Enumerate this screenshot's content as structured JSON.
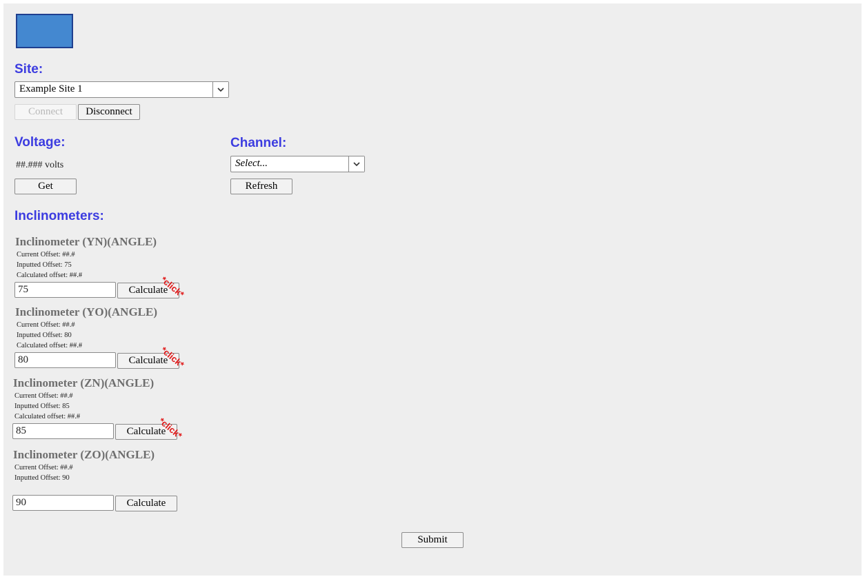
{
  "site": {
    "heading": "Site:",
    "selected": "Example Site 1",
    "connect_label": "Connect",
    "disconnect_label": "Disconnect"
  },
  "voltage": {
    "heading": "Voltage:",
    "value": "##.### volts",
    "get_label": "Get"
  },
  "channel": {
    "heading": "Channel:",
    "selected": "Select...",
    "refresh_label": "Refresh"
  },
  "inclinometers": {
    "heading": "Inclinometers:",
    "calculate_label": "Calculate",
    "click_mark": "*click*",
    "items": [
      {
        "title": "Inclinometer (YN)(ANGLE)",
        "current": "Current Offset: ##.#",
        "inputted": "Inputted Offset: 75",
        "calculated": "Calculated offset: ##.#",
        "value": "75"
      },
      {
        "title": "Inclinometer (YO)(ANGLE)",
        "current": "Current Offset: ##.#",
        "inputted": "Inputted Offset: 80",
        "calculated": "Calculated offset: ##.#",
        "value": "80"
      },
      {
        "title": "Inclinometer (ZN)(ANGLE)",
        "current": "Current Offset: ##.#",
        "inputted": "Inputted Offset: 85",
        "calculated": "Calculated offset: ##.#",
        "value": "85"
      },
      {
        "title": "Inclinometer (ZO)(ANGLE)",
        "current": "Current Offset: ##.#",
        "inputted": "Inputted Offset: 90",
        "value": "90"
      }
    ]
  },
  "submit_label": "Submit",
  "colors": {
    "heading": "#3c3ce0",
    "logo": "#4488d0",
    "click_mark": "#e01818"
  }
}
